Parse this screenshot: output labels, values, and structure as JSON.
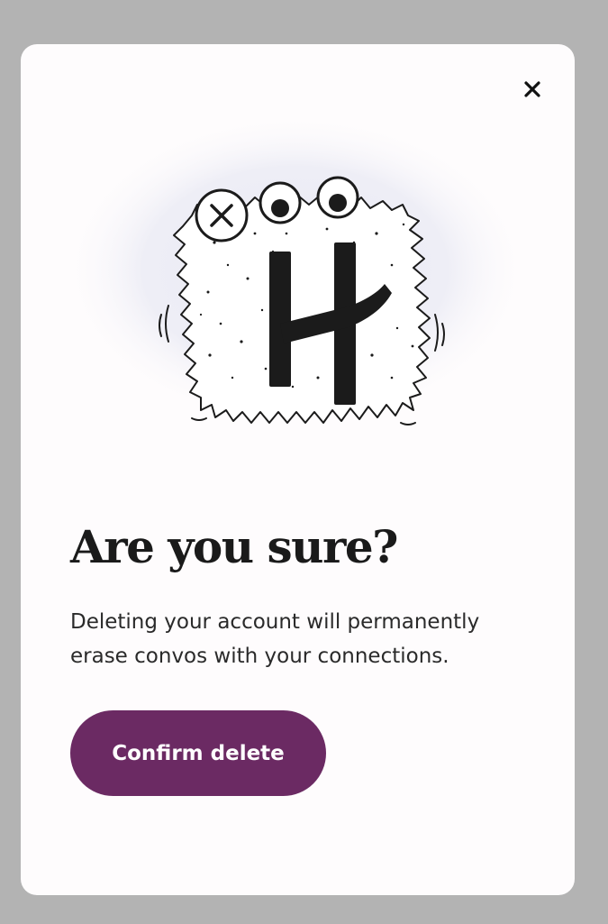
{
  "dialog": {
    "title": "Are you sure?",
    "message": "Deleting your account will permanently erase convos with your connections.",
    "confirm_label": "Confirm delete",
    "close_icon": "close-icon",
    "illustration": "hinge-logo-monster-illustration"
  },
  "colors": {
    "overlay": "#b3b3b3",
    "card": "#fefcfd",
    "accent": "#6b2a63",
    "text": "#1a1a1a",
    "halo": "#ececf4"
  }
}
